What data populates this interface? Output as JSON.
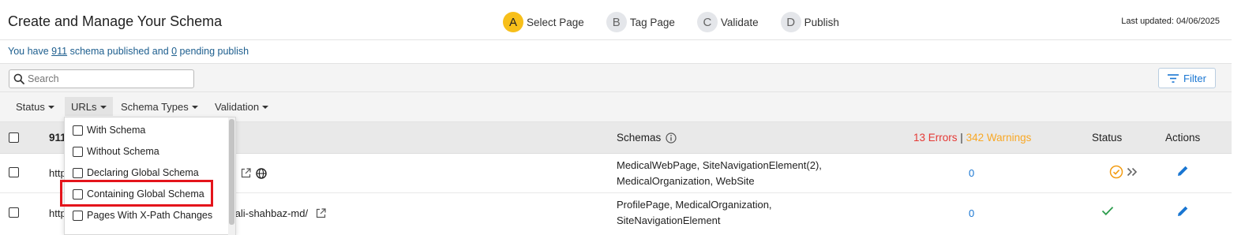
{
  "header": {
    "title": "Create and Manage Your Schema",
    "steps": [
      {
        "letter": "A",
        "label": "Select Page",
        "active": true
      },
      {
        "letter": "B",
        "label": "Tag Page",
        "active": false
      },
      {
        "letter": "C",
        "label": "Validate",
        "active": false
      },
      {
        "letter": "D",
        "label": "Publish",
        "active": false
      }
    ],
    "last_updated": "Last updated: 04/06/2025"
  },
  "summary": {
    "prefix": "You have ",
    "published_count": "911",
    "middle": " schema published and ",
    "pending_count": "0",
    "suffix": " pending publish"
  },
  "search": {
    "placeholder": "Search",
    "value": ""
  },
  "filter_button": {
    "label": "Filter"
  },
  "filters": {
    "status": "Status",
    "urls": "URLs",
    "schema_types": "Schema Types",
    "validation": "Validation"
  },
  "table": {
    "header": {
      "url_count": "911",
      "schemas": "Schemas",
      "errors": "13 Errors",
      "separator": "|",
      "warnings": "342 Warnings",
      "status": "Status",
      "actions": "Actions"
    },
    "rows": [
      {
        "url_start": "http",
        "url_end": "/",
        "schemas_line1": "MedicalWebPage, SiteNavigationElement(2),",
        "schemas_line2": "MedicalOrganization, WebSite",
        "count": "0"
      },
      {
        "url_start": "http",
        "url_end": "/ali-shahbaz-md/",
        "schemas_line1": "ProfilePage, MedicalOrganization,",
        "schemas_line2": "SiteNavigationElement",
        "count": "0"
      }
    ]
  },
  "urls_dropdown": {
    "options": [
      "With Schema",
      "Without Schema",
      "Declaring Global Schema",
      "Containing Global Schema",
      "Pages With X-Path Changes"
    ]
  },
  "colors": {
    "accent": "#1976d2",
    "step_active": "#f7bf1a",
    "errors": "#e53935",
    "warnings": "#f9a825",
    "highlight": "#e4141b",
    "status_pending": "#f39c12",
    "status_ok": "#2e9d4e"
  },
  "icons": {
    "search": "search-icon",
    "filter": "filter-lines-icon",
    "info": "info-circle-icon",
    "external_link": "external-link-icon",
    "globe": "globe-icon",
    "pending_status": "clock-check-icon",
    "expand": "double-chevron-right-icon",
    "ok_status": "checkmark-icon",
    "edit": "pencil-icon"
  }
}
